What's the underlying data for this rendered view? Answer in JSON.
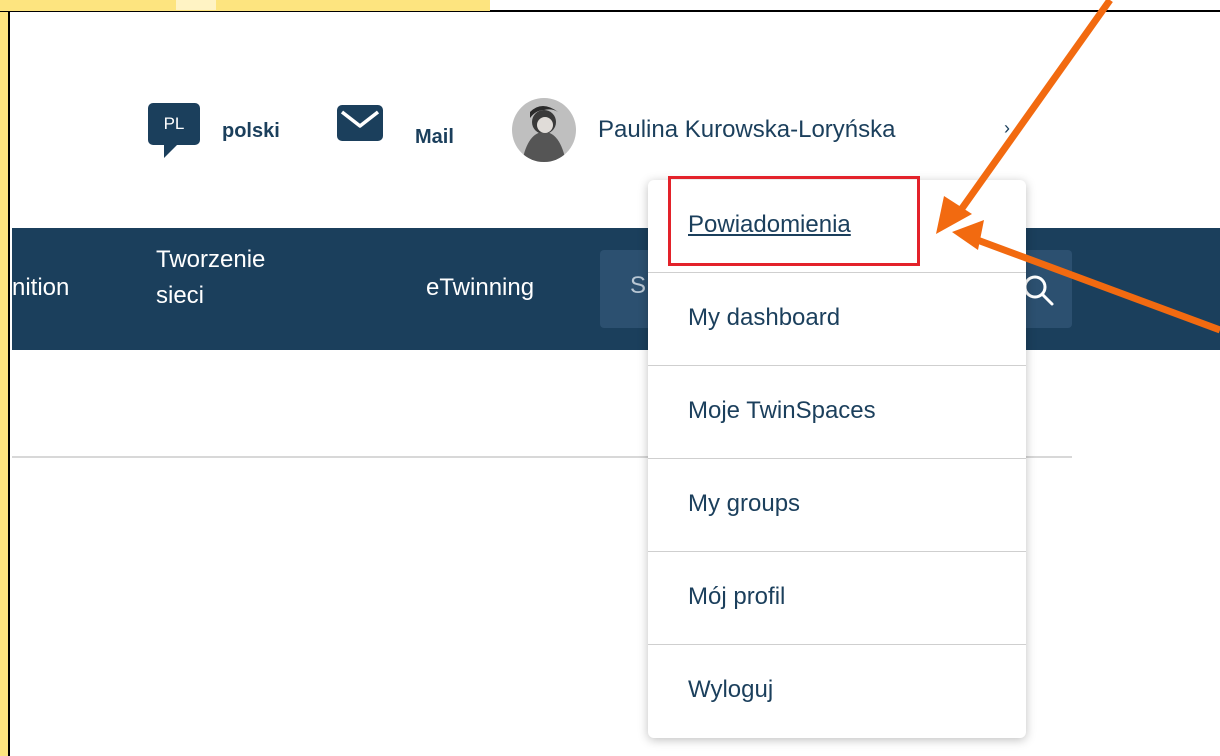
{
  "header": {
    "language_code": "PL",
    "language_label": "polski",
    "mail_label": "Mail",
    "user_name": "Paulina Kurowska-Loryńska",
    "chevron": "›"
  },
  "navbar": {
    "items": [
      {
        "label": "nition"
      },
      {
        "label": "Tworzenie sieci"
      },
      {
        "label": "eTwinning"
      }
    ],
    "search_placeholder": "S"
  },
  "dropdown": {
    "items": [
      {
        "label": "Powiadomienia",
        "active": true
      },
      {
        "label": "My dashboard"
      },
      {
        "label": "Moje TwinSpaces"
      },
      {
        "label": "My groups"
      },
      {
        "label": "Mój profil"
      },
      {
        "label": "Wyloguj"
      }
    ]
  },
  "colors": {
    "brand": "#1b3f5c",
    "highlight": "#e3222a",
    "annotation_arrow": "#f26a10",
    "frame": "#fde47f"
  },
  "icons": [
    "mail-icon",
    "search-icon",
    "avatar",
    "chevron-down-icon"
  ]
}
